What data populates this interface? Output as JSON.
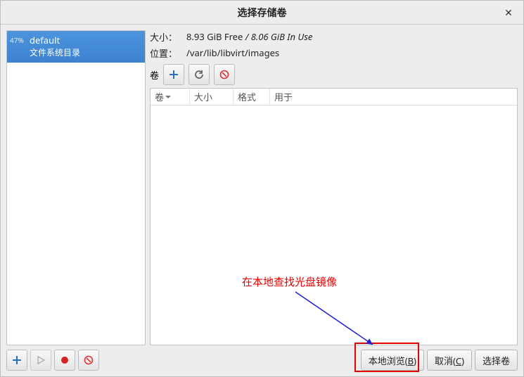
{
  "window": {
    "title": "选择存储卷",
    "close_glyph": "✕"
  },
  "pools": [
    {
      "percent": "47%",
      "name": "default",
      "subtitle": "文件系统目录"
    }
  ],
  "details": {
    "size_label": "大小：",
    "free_value": "8.93 GiB Free",
    "sep": " / ",
    "inuse_value": "8.06 GiB In Use",
    "location_label": "位置：",
    "location_value": "/var/lib/libvirt/images",
    "volumes_label": "卷"
  },
  "vol_columns": {
    "c1": "卷",
    "c2": "大小",
    "c3": "格式",
    "c4": "用于"
  },
  "bottom_buttons": {
    "browse_local_pre": "本地浏览(",
    "browse_local_key": "B",
    "browse_local_post": ")",
    "cancel_pre": "取消(",
    "cancel_key": "C",
    "cancel_post": ")",
    "choose": "选择卷"
  },
  "annotation": {
    "text": "在本地查找光盘镜像"
  }
}
